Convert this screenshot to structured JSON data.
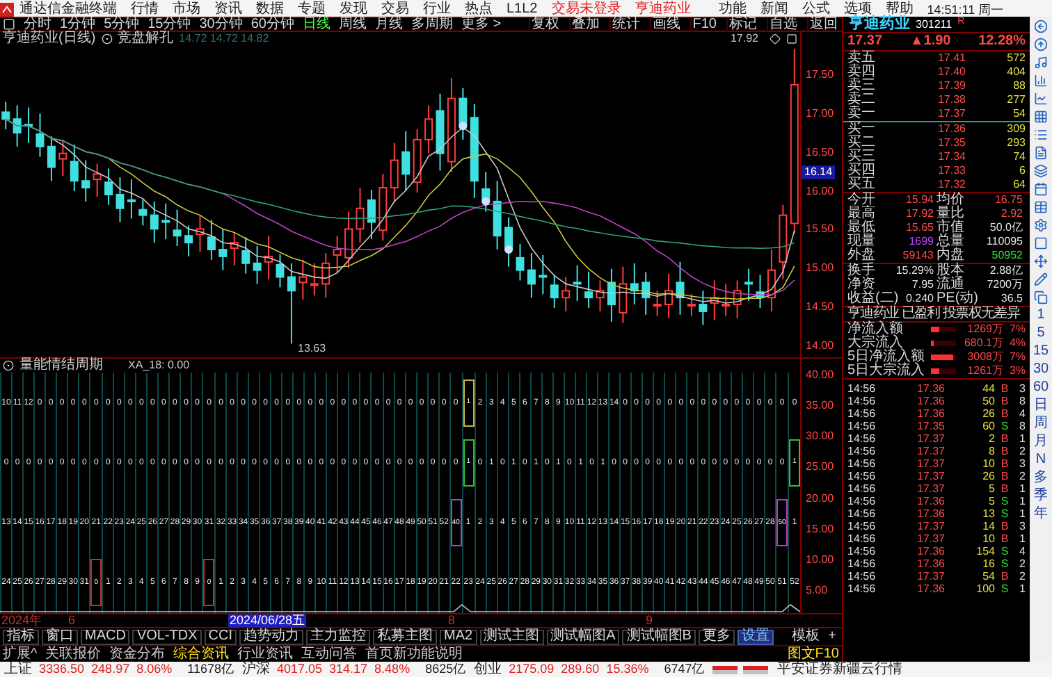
{
  "window": {
    "title": "通达信金融终端",
    "menu": [
      "行情",
      "市场",
      "资讯",
      "数据",
      "专题",
      "发现",
      "交易",
      "行业",
      "热点",
      "L1L2"
    ],
    "trade_status": "交易未登录",
    "stock_link": "亨迪药业",
    "right_menu": [
      "功能",
      "新闻",
      "公式",
      "选项",
      "帮助"
    ],
    "clock": "14:51:11 周一"
  },
  "period_tabs": [
    {
      "label": "分时",
      "selected": false
    },
    {
      "label": "1分钟",
      "selected": false
    },
    {
      "label": "5分钟",
      "selected": false
    },
    {
      "label": "15分钟",
      "selected": false
    },
    {
      "label": "30分钟",
      "selected": false
    },
    {
      "label": "60分钟",
      "selected": false
    },
    {
      "label": "日线",
      "selected": true
    },
    {
      "label": "周线",
      "selected": false
    },
    {
      "label": "月线",
      "selected": false
    },
    {
      "label": "多周期",
      "selected": false
    },
    {
      "label": "更多 >",
      "selected": false
    }
  ],
  "chart_tools": [
    "复权",
    "叠加",
    "统计",
    "画线",
    "F10",
    "标记",
    "自选",
    "返回"
  ],
  "chart": {
    "title": "亨迪药业(日线)",
    "indicator": "竞盘解孔",
    "readout": "14.72 14.72 14.82",
    "high_label": "17.92",
    "low_label": "13.63",
    "price_axis": [
      "17.50",
      "17.00",
      "16.50",
      "16.00",
      "15.50",
      "15.00",
      "14.50",
      "14.00"
    ],
    "current_price_tag": "16.14"
  },
  "indicator_pane": {
    "title": "量能情结周期",
    "readout": "XA_18: 0.00",
    "axis": [
      "40.00",
      "35.00",
      "30.00",
      "25.00",
      "20.00",
      "15.00",
      "10.00",
      "5.00"
    ],
    "rows": [
      {
        "cells": [
          "10",
          "11",
          "12",
          "0",
          "0",
          "0",
          "0",
          "0",
          "0",
          "0",
          "0",
          "0",
          "0",
          "0",
          "0",
          "0",
          "0",
          "0",
          "0",
          "0",
          "0",
          "0",
          "0",
          "0",
          "0",
          "0",
          "0",
          "0",
          "0",
          "0",
          "0",
          "0",
          "0",
          "0",
          "0",
          "0",
          "0",
          "0",
          "0",
          "0",
          "0",
          {
            "text": "1",
            "color": "#c8b840"
          },
          "2",
          "3",
          "4",
          "5",
          "6",
          "7",
          "8",
          "9",
          "10",
          "11",
          "12",
          "13",
          "14",
          "0",
          "0",
          "0",
          "0",
          "0",
          "0",
          "0",
          "0",
          "0",
          "0",
          "0",
          "0",
          "0",
          "0",
          "0",
          "0"
        ]
      },
      {
        "cells": [
          "0",
          "0",
          "0",
          "0",
          "0",
          "0",
          "0",
          "0",
          "0",
          "0",
          "0",
          "0",
          "0",
          "0",
          "0",
          "0",
          "0",
          "0",
          "0",
          "0",
          "0",
          "0",
          "0",
          "0",
          "0",
          "0",
          "0",
          "0",
          "0",
          "0",
          "0",
          "0",
          "0",
          "0",
          "0",
          "0",
          "0",
          "0",
          "0",
          "0",
          "0",
          {
            "text": "1",
            "color": "#30c030"
          },
          "0",
          "1",
          "0",
          "1",
          "0",
          "1",
          "0",
          "1",
          "0",
          "1",
          "0",
          "1",
          "0",
          "0",
          "0",
          "0",
          "0",
          "0",
          "0",
          "0",
          "0",
          "0",
          "0",
          "0",
          "0",
          "0",
          "0",
          "0",
          {
            "text": "1",
            "color": "#30c030"
          }
        ]
      },
      {
        "cells": [
          "13",
          "14",
          "15",
          "16",
          "17",
          "18",
          "19",
          "20",
          "21",
          "22",
          "23",
          "24",
          "25",
          "26",
          "27",
          "28",
          "29",
          "30",
          "31",
          "32",
          "33",
          "34",
          "35",
          "36",
          "37",
          "38",
          "39",
          "40",
          "41",
          "42",
          "43",
          "44",
          "45",
          "46",
          "47",
          "48",
          "49",
          "50",
          "51",
          "52",
          {
            "text": "40",
            "color": "#b040c0"
          },
          "1",
          "2",
          "3",
          "4",
          "5",
          "6",
          "7",
          "8",
          "9",
          "10",
          "11",
          "12",
          "13",
          "14",
          "15",
          "16",
          "17",
          "18",
          "19",
          "20",
          "21",
          "22",
          "23",
          "24",
          "25",
          "26",
          "27",
          "28",
          {
            "text": "50",
            "color": "#b040c0"
          },
          "1"
        ]
      },
      {
        "cells": [
          "24",
          "25",
          "26",
          "27",
          "28",
          "29",
          "30",
          "31",
          {
            "text": "0",
            "color": "#c03030"
          },
          "1",
          "2",
          "3",
          "4",
          "5",
          "6",
          "7",
          "8",
          "9",
          {
            "text": "0",
            "color": "#c03030"
          },
          "1",
          "2",
          "3",
          "4",
          "5",
          "6",
          "7",
          "8",
          "9",
          "10",
          "11",
          "12",
          "13",
          "14",
          "15",
          "16",
          "17",
          "18",
          "19",
          "20",
          "21",
          "22",
          "23",
          "24",
          "25",
          "26",
          "27",
          "28",
          "29",
          "30",
          "31",
          "32",
          "33",
          "34",
          "35",
          "36",
          "37",
          "38",
          "39",
          "40",
          "41",
          "42",
          "43",
          "44",
          "45",
          "46",
          "47",
          "48",
          "49",
          "50",
          "51",
          "52"
        ]
      }
    ]
  },
  "date_axis": [
    {
      "label": "2024年",
      "selected": false
    },
    {
      "label": "6",
      "selected": false
    },
    {
      "label": "2024/06/28五",
      "selected": true
    },
    {
      "label": "8",
      "selected": false
    },
    {
      "label": "9",
      "selected": false
    }
  ],
  "indicator_tabs": [
    {
      "label": "指标",
      "selected": false
    },
    {
      "label": "窗口",
      "selected": false
    },
    {
      "label": "MACD",
      "selected": false
    },
    {
      "label": "VOL-TDX",
      "selected": false
    },
    {
      "label": "CCI",
      "selected": false
    },
    {
      "label": "趋势动力",
      "selected": false
    },
    {
      "label": "主力监控",
      "selected": false
    },
    {
      "label": "私募主图",
      "selected": false
    },
    {
      "label": "MA2",
      "selected": false
    },
    {
      "label": "测试主图",
      "selected": false
    },
    {
      "label": "测试幅图A",
      "selected": false
    },
    {
      "label": "测试幅图B",
      "selected": false
    },
    {
      "label": "更多",
      "selected": false
    },
    {
      "label": "设置",
      "selected": true
    }
  ],
  "template_buttons": [
    "模板",
    "+"
  ],
  "info_tabs": [
    {
      "label": "扩展^",
      "selected": false
    },
    {
      "label": "关联报价",
      "selected": false
    },
    {
      "label": "资金分布",
      "selected": false
    },
    {
      "label": "综合资讯",
      "selected": true
    },
    {
      "label": "行业资讯",
      "selected": false
    },
    {
      "label": "互动问答",
      "selected": false
    },
    {
      "label": "首页新功能说明",
      "selected": false
    }
  ],
  "info_right": "图文F10",
  "status_bar": {
    "indices": [
      {
        "name": "上证",
        "value": "3336.50",
        "change": "248.97",
        "pct": "8.06%",
        "amount": "11678亿"
      },
      {
        "name": "沪深",
        "value": "4017.05",
        "change": "314.17",
        "pct": "8.48%",
        "amount": "8625亿"
      },
      {
        "name": "创业",
        "value": "2175.09",
        "change": "289.60",
        "pct": "15.36%",
        "amount": "6747亿"
      }
    ],
    "broker": "平安证券新疆云行情"
  },
  "quote": {
    "name": "亨迪药业",
    "code": "301211",
    "flag": "R",
    "price": "17.37",
    "change": "▲1.90",
    "pct": "12.28%",
    "asks": [
      {
        "label": "卖五",
        "price": "17.41",
        "volume": "572"
      },
      {
        "label": "卖四",
        "price": "17.40",
        "volume": "404"
      },
      {
        "label": "卖三",
        "price": "17.39",
        "volume": "88"
      },
      {
        "label": "卖二",
        "price": "17.38",
        "volume": "277"
      },
      {
        "label": "卖一",
        "price": "17.37",
        "volume": "54"
      }
    ],
    "bids": [
      {
        "label": "买一",
        "price": "17.36",
        "volume": "309"
      },
      {
        "label": "买二",
        "price": "17.35",
        "volume": "293"
      },
      {
        "label": "买三",
        "price": "17.34",
        "volume": "74"
      },
      {
        "label": "买四",
        "price": "17.33",
        "volume": "6"
      },
      {
        "label": "买五",
        "price": "17.32",
        "volume": "64"
      }
    ],
    "stats_a": [
      {
        "label": "今开",
        "value": "15.94",
        "color": "#ff4848"
      },
      {
        "label": "均价",
        "value": "16.75",
        "color": "#ff4848"
      },
      {
        "label": "最高",
        "value": "17.92",
        "color": "#ff4848"
      },
      {
        "label": "量比",
        "value": "2.92",
        "color": "#ff4848"
      },
      {
        "label": "最低",
        "value": "15.65",
        "color": "#ff4848"
      },
      {
        "label": "市值",
        "value": "50.0亿",
        "color": "#e0e0e0"
      },
      {
        "label": "现量",
        "value": "1699",
        "color": "#c040ff"
      },
      {
        "label": "总量",
        "value": "110095",
        "color": "#e0e0e0"
      },
      {
        "label": "外盘",
        "value": "59143",
        "color": "#ff4848"
      },
      {
        "label": "内盘",
        "value": "50952",
        "color": "#30e030"
      }
    ],
    "stats_b": [
      {
        "label": "换手",
        "value": "15.29%",
        "color": "#e0e0e0"
      },
      {
        "label": "股本",
        "value": "2.88亿",
        "color": "#e0e0e0"
      },
      {
        "label": "净资",
        "value": "7.95",
        "color": "#e0e0e0"
      },
      {
        "label": "流通",
        "value": "7200万",
        "color": "#e0e0e0"
      },
      {
        "label": "收益(二)",
        "value": "0.240",
        "color": "#e0e0e0"
      },
      {
        "label": "PE(动)",
        "value": "36.5",
        "color": "#e0e0e0"
      }
    ],
    "profile": "亨迪药业 已盈利 投票权无差异",
    "flows": [
      {
        "label": "净流入额",
        "level": 0.35,
        "amount": "1269万",
        "pct": "7%"
      },
      {
        "label": "大宗流入",
        "level": 0.12,
        "amount": "680.1万",
        "pct": "4%"
      },
      {
        "label": "5日净流入额",
        "level": 0.9,
        "amount": "3008万",
        "pct": "7%"
      },
      {
        "label": "5日大宗流入",
        "level": 0.35,
        "amount": "1261万",
        "pct": "3%"
      }
    ],
    "trades": [
      {
        "time": "14:56",
        "price": "17.36",
        "volume": "44",
        "side": "B",
        "kind": "buy",
        "count": "3"
      },
      {
        "time": "14:56",
        "price": "17.36",
        "volume": "50",
        "side": "B",
        "kind": "buy",
        "count": "8"
      },
      {
        "time": "14:56",
        "price": "17.36",
        "volume": "26",
        "side": "B",
        "kind": "buy",
        "count": "4"
      },
      {
        "time": "14:56",
        "price": "17.35",
        "volume": "60",
        "side": "S",
        "kind": "sell",
        "count": "8"
      },
      {
        "time": "14:56",
        "price": "17.37",
        "volume": "2",
        "side": "B",
        "kind": "buy",
        "count": "1"
      },
      {
        "time": "14:56",
        "price": "17.37",
        "volume": "8",
        "side": "B",
        "kind": "buy",
        "count": "2"
      },
      {
        "time": "14:56",
        "price": "17.37",
        "volume": "10",
        "side": "B",
        "kind": "buy",
        "count": "3"
      },
      {
        "time": "14:56",
        "price": "17.37",
        "volume": "26",
        "side": "B",
        "kind": "buy",
        "count": "2"
      },
      {
        "time": "14:56",
        "price": "17.37",
        "volume": "5",
        "side": "B",
        "kind": "buy",
        "count": "1"
      },
      {
        "time": "14:56",
        "price": "17.36",
        "volume": "5",
        "side": "S",
        "kind": "sell",
        "count": "1"
      },
      {
        "time": "14:56",
        "price": "17.36",
        "volume": "13",
        "side": "S",
        "kind": "sell",
        "count": "1"
      },
      {
        "time": "14:56",
        "price": "17.37",
        "volume": "14",
        "side": "B",
        "kind": "buy",
        "count": "3"
      },
      {
        "time": "14:56",
        "price": "17.37",
        "volume": "10",
        "side": "B",
        "kind": "buy",
        "count": "1"
      },
      {
        "time": "14:56",
        "price": "17.36",
        "volume": "154",
        "side": "S",
        "kind": "sell",
        "count": "4"
      },
      {
        "time": "14:56",
        "price": "17.36",
        "volume": "16",
        "side": "S",
        "kind": "sell",
        "count": "2"
      },
      {
        "time": "14:56",
        "price": "17.37",
        "volume": "54",
        "side": "B",
        "kind": "buy",
        "count": "2"
      },
      {
        "time": "14:56",
        "price": "17.36",
        "volume": "100",
        "side": "S",
        "kind": "sell",
        "count": "1"
      }
    ]
  },
  "side_toolbar": {
    "periods": [
      "1",
      "5",
      "15",
      "30",
      "60",
      "日",
      "周",
      "月",
      "N",
      "多",
      "季",
      "年"
    ]
  }
}
